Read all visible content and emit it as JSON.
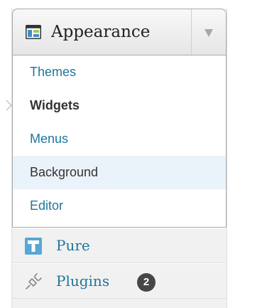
{
  "appearance_menu": {
    "title": "Appearance",
    "icon": "appearance-icon",
    "toggle_icon": "chevron-down-icon",
    "submenu": [
      {
        "label": "Themes"
      },
      {
        "label": "Widgets",
        "current": true
      },
      {
        "label": "Menus"
      },
      {
        "label": "Background",
        "hover": true
      },
      {
        "label": "Editor"
      }
    ]
  },
  "menu_items": [
    {
      "label": "Pure",
      "icon": "pure-theme-icon"
    },
    {
      "label": "Plugins",
      "icon": "plugin-plug-icon",
      "badge": "2"
    }
  ],
  "colors": {
    "link": "#21759b",
    "current_text": "#333333",
    "hover_bg": "#eaf2fa",
    "menu_bg": "#f1f1f1",
    "badge_bg": "#464646",
    "pure_icon": "#5aa6d6"
  }
}
